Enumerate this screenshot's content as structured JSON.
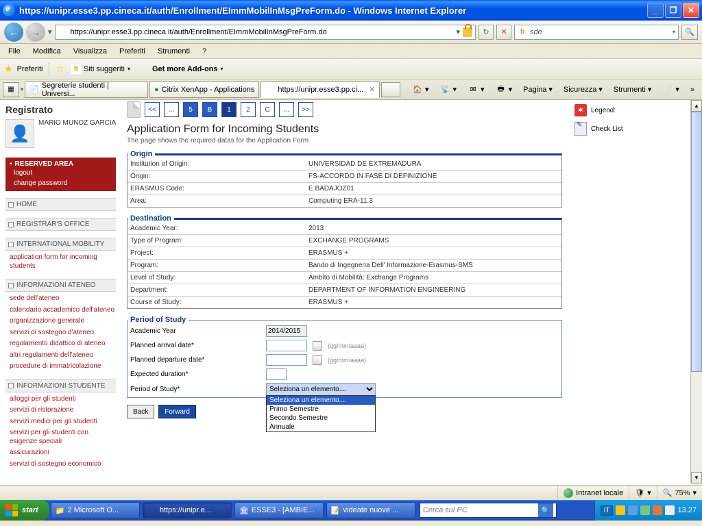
{
  "window": {
    "title": "https://unipr.esse3.pp.cineca.it/auth/Enrollment/EImmMobilInMsgPreForm.do - Windows Internet Explorer",
    "url": "https://unipr.esse3.pp.cineca.it/auth/Enrollment/EImmMobilInMsgPreForm.do",
    "search_placeholder": "sde"
  },
  "menubar": [
    "File",
    "Modifica",
    "Visualizza",
    "Preferiti",
    "Strumenti",
    "?"
  ],
  "favbar": {
    "preferiti": "Preferiti",
    "siti": "Siti suggeriti",
    "addons": "Get more Add-ons"
  },
  "tabs": [
    {
      "label": "Segreterie studenti | Universi...",
      "active": false
    },
    {
      "label": "Citrix XenApp - Applications",
      "active": false
    },
    {
      "label": "https://unipr.esse3.pp.ci...",
      "active": true
    }
  ],
  "cmds": {
    "pagina": "Pagina",
    "sicurezza": "Sicurezza",
    "strumenti": "Strumenti"
  },
  "sidebar": {
    "heading": "Registrato",
    "user": "MARIO MUNOZ GARCIA",
    "reserved": {
      "title": "RESERVED AREA",
      "logout": "logout",
      "changepw": "change password"
    },
    "heads": {
      "home": "HOME",
      "registrar": "REGISTRAR'S OFFICE",
      "intl": "INTERNATIONAL MOBILITY",
      "info_ateneo": "INFORMAZIONI ATENEO",
      "info_stud": "INFORMAZIONI STUDENTE"
    },
    "intl_link": "application form for incoming students",
    "ateneo_links": [
      "sede dell'ateneo",
      "calendario accademico dell'ateneo",
      "organizzazione generale",
      "servizi di sostegno d'ateneo",
      "regolamento didattico di ateneo",
      "altri regolamenti dell'ateneo",
      "procedure di immatricolazione"
    ],
    "stud_links": [
      "alloggi per gli studenti",
      "servizi di ristorazione",
      "servizi medici per gli studenti",
      "servizi per gli studenti con esigenze speciali",
      "assicurazioni",
      "servizi di sostegno economico"
    ]
  },
  "crumbs": [
    "<<",
    "...",
    "5",
    "B",
    "1",
    "2",
    "C",
    "...",
    ">>"
  ],
  "page": {
    "h1": "Application Form for Incoming Students",
    "sub": "The page shows the required datas for the Application Form"
  },
  "origin": {
    "legend": "Origin",
    "rows": [
      {
        "l": "Institution of Origin:",
        "v": "UNIVERSIDAD DE EXTREMADURA"
      },
      {
        "l": "Origin:",
        "v": "FS-ACCORDO IN FASE DI DEFINIZIONE"
      },
      {
        "l": "ERASMUS Code:",
        "v": "E BADAJOZ01"
      },
      {
        "l": "Area:",
        "v": "Computing   ERA-11.3"
      }
    ]
  },
  "dest": {
    "legend": "Destination",
    "rows": [
      {
        "l": "Academic Year:",
        "v": "2013"
      },
      {
        "l": "Type of Program:",
        "v": "EXCHANGE PROGRAMS"
      },
      {
        "l": "Project:",
        "v": "ERASMUS +"
      },
      {
        "l": "Program:",
        "v": "Bando di Ingegneria Dell' Informazione-Erasmus-SMS"
      },
      {
        "l": "Level of Study:",
        "v": "Ambito di Mobilità: Exchange Programs"
      },
      {
        "l": "Department:",
        "v": "DEPARTMENT OF INFORMATION ENGINEERING"
      },
      {
        "l": "Course of Study:",
        "v": "ERASMUS +"
      }
    ]
  },
  "period": {
    "legend": "Period of Study",
    "year_l": "Academic Year",
    "year_v": "2014/2015",
    "arr_l": "Planned arrival date*",
    "dep_l": "Planned departure date*",
    "dur_l": "Expected duration*",
    "pos_l": "Period of Study*",
    "date_hint": "(gg/mm/aaaa)",
    "select_v": "Seleziona un elemento....",
    "options": [
      "Seleziona un elemento....",
      "Primo Semestre",
      "Secondo Semestre",
      "Annuale"
    ]
  },
  "btns": {
    "back": "Back",
    "forward": "Forward"
  },
  "right": {
    "legend": "Legend:",
    "check": "Check List"
  },
  "status": {
    "zone": "Intranet locale",
    "zoom": "75%"
  },
  "taskbar": {
    "start": "start",
    "tasks": [
      "2 Microsoft O...",
      "https://unipr.e...",
      "ESSE3 - [AMBIE...",
      "videate nuove ..."
    ],
    "search": "Cerca sul PC",
    "lang": "IT",
    "clock": "13.27"
  }
}
